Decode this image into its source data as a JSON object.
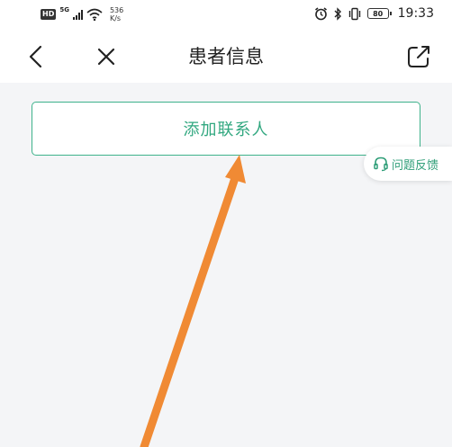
{
  "status_bar": {
    "hd": "HD",
    "network": "5G",
    "speed_value": "536",
    "speed_unit": "K/s",
    "battery": "80",
    "time": "19:33"
  },
  "nav": {
    "title": "患者信息",
    "back_icon": "chevron-left-icon",
    "close_icon": "close-icon",
    "share_icon": "share-external-icon"
  },
  "main": {
    "add_contact_label": "添加联系人"
  },
  "feedback": {
    "label": "问题反馈",
    "icon": "headset-icon"
  },
  "colors": {
    "accent": "#3eb28b",
    "background": "#f4f5f7",
    "annotation_arrow": "#f08a34"
  }
}
